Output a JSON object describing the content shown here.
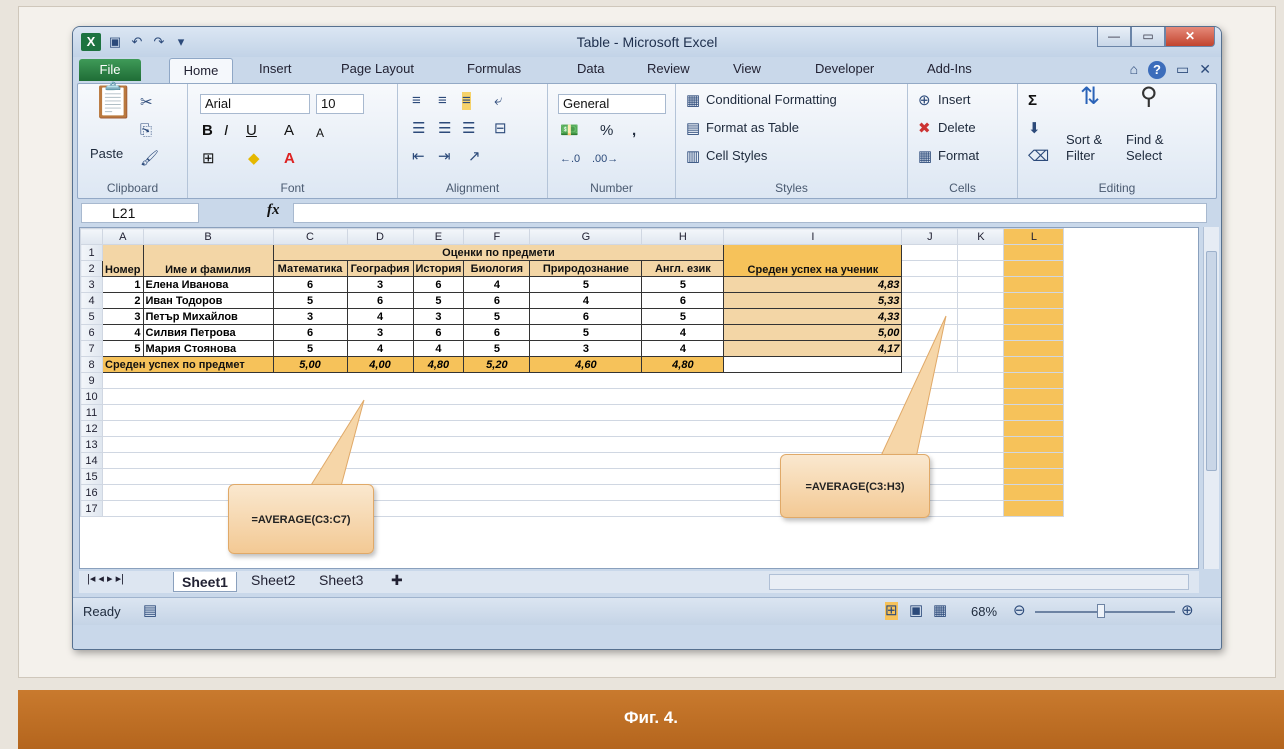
{
  "window": {
    "title": "Table  -  Microsoft Excel"
  },
  "tabs": [
    "File",
    "Home",
    "Insert",
    "Page Layout",
    "Formulas",
    "Data",
    "Review",
    "View",
    "Developer",
    "Add-Ins"
  ],
  "ribbon": {
    "clipboard": {
      "paste": "Paste",
      "label": "Clipboard"
    },
    "font": {
      "name": "Arial",
      "size": "10",
      "label": "Font"
    },
    "alignment": {
      "label": "Alignment"
    },
    "number": {
      "format": "General",
      "percent": "%",
      "comma": ",",
      "label": "Number"
    },
    "styles": {
      "conditional": "Conditional Formatting",
      "format_table": "Format as Table",
      "cell_styles": "Cell Styles",
      "label": "Styles"
    },
    "cells": {
      "insert": "Insert",
      "delete": "Delete",
      "format": "Format",
      "label": "Cells"
    },
    "editing": {
      "sort1": "Sort &",
      "sort2": "Filter",
      "find1": "Find &",
      "find2": "Select",
      "label": "Editing"
    }
  },
  "formula_bar": {
    "name_box": "L21",
    "fx": "fx",
    "formula": ""
  },
  "columns": [
    "A",
    "B",
    "C",
    "D",
    "E",
    "F",
    "G",
    "H",
    "I",
    "J",
    "K",
    "L"
  ],
  "sheet": {
    "group_header": "Оценки по предмети",
    "headers": {
      "num": "Номер",
      "name": "Име и фамилия",
      "subjects": [
        "Математика",
        "География",
        "История",
        "Биология",
        "Природознание",
        "Англ. език"
      ],
      "avg": "Среден успех на ученик"
    },
    "students": [
      {
        "n": "1",
        "name": "Елена Иванова",
        "grades": [
          "6",
          "3",
          "6",
          "4",
          "5",
          "5"
        ],
        "avg": "4,83"
      },
      {
        "n": "2",
        "name": "Иван Тодоров",
        "grades": [
          "5",
          "6",
          "5",
          "6",
          "4",
          "6"
        ],
        "avg": "5,33"
      },
      {
        "n": "3",
        "name": "Петър Михайлов",
        "grades": [
          "3",
          "4",
          "3",
          "5",
          "6",
          "5"
        ],
        "avg": "4,33"
      },
      {
        "n": "4",
        "name": "Силвия Петрова",
        "grades": [
          "6",
          "3",
          "6",
          "6",
          "5",
          "4"
        ],
        "avg": "5,00"
      },
      {
        "n": "5",
        "name": "Мария Стоянова",
        "grades": [
          "5",
          "4",
          "4",
          "5",
          "3",
          "4"
        ],
        "avg": "4,17"
      }
    ],
    "subject_avg_label": "Среден успех по предмет",
    "subject_avgs": [
      "5,00",
      "4,00",
      "4,80",
      "5,20",
      "4,60",
      "4,80"
    ],
    "row_numbers": [
      "1",
      "2",
      "3",
      "4",
      "5",
      "6",
      "7",
      "8",
      "9",
      "10",
      "11",
      "12",
      "13",
      "14",
      "15",
      "16",
      "17"
    ]
  },
  "callouts": {
    "left": "=AVERAGE(C3:C7)",
    "right": "=AVERAGE(C3:H3)"
  },
  "sheet_tabs": [
    "Sheet1",
    "Sheet2",
    "Sheet3"
  ],
  "status": {
    "ready": "Ready",
    "zoom": "68%"
  },
  "caption": "Фиг. 4."
}
